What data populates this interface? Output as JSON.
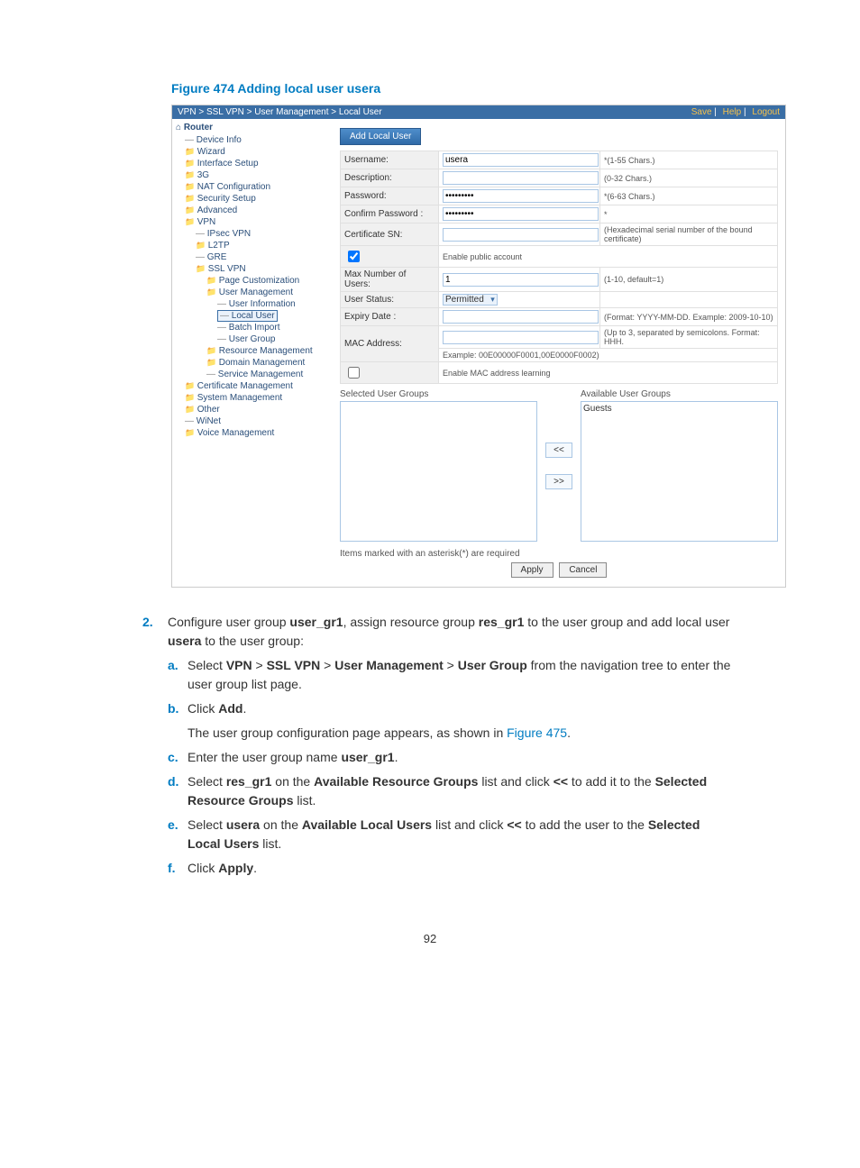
{
  "figure": {
    "caption": "Figure 474 Adding local user usera"
  },
  "crumb": {
    "path": "VPN > SSL VPN > User Management > Local User",
    "save": "Save",
    "help": "Help",
    "logout": "Logout"
  },
  "nav": {
    "root": "Router",
    "device_info": "Device Info",
    "wizard": "Wizard",
    "iface": "Interface Setup",
    "g3": "3G",
    "nat": "NAT Configuration",
    "sec": "Security Setup",
    "adv": "Advanced",
    "vpn": "VPN",
    "ipsec": "IPsec VPN",
    "l2tp": "L2TP",
    "gre": "GRE",
    "sslvpn": "SSL VPN",
    "pagec": "Page Customization",
    "usermgmt": "User Management",
    "userinfo": "User Information",
    "localuser": "Local User",
    "batch": "Batch Import",
    "usergroup": "User Group",
    "resmgmt": "Resource Management",
    "dommgmt": "Domain Management",
    "svcmgmt": "Service Management",
    "certmgmt": "Certificate Management",
    "sysmgmt": "System Management",
    "other": "Other",
    "winet": "WiNet",
    "voice": "Voice Management"
  },
  "form": {
    "button": "Add Local User",
    "username_l": "Username:",
    "username_v": "usera",
    "username_h": "*(1-55 Chars.)",
    "desc_l": "Description:",
    "desc_h": "(0-32 Chars.)",
    "pwd_l": "Password:",
    "pwd_v": "•••••••••",
    "pwd_h": "*(6-63 Chars.)",
    "cpwd_l": "Confirm Password :",
    "cpwd_v": "•••••••••",
    "cpwd_h": "*",
    "cert_l": "Certificate SN:",
    "cert_h": "(Hexadecimal serial number of the bound certificate)",
    "enable_pub": "Enable public account",
    "max_l": "Max Number of Users:",
    "max_v": "1",
    "max_h": "(1-10, default=1)",
    "status_l": "User Status:",
    "status_v": "Permitted",
    "expiry_l": "Expiry Date :",
    "expiry_h": "(Format: YYYY-MM-DD. Example: 2009-10-10)",
    "mac_l": "MAC Address:",
    "mac_h": "(Up to 3, separated by semicolons. Format: HHH.",
    "mac_ex": "Example: 00E00000F0001,00E0000F0002)",
    "enable_mac": "Enable MAC address learning",
    "sel_groups": "Selected User Groups",
    "avail_groups": "Available User Groups",
    "guests": "Guests",
    "move_l": "<<",
    "move_r": ">>",
    "note": "Items marked with an asterisk(*) are required",
    "apply": "Apply",
    "cancel": "Cancel"
  },
  "instr": {
    "num": "2.",
    "intro1": "Configure user group ",
    "b1": "user_gr1",
    "intro2": ", assign resource group ",
    "b2": "res_gr1",
    "intro3": " to the user group and add local user ",
    "b3": "usera",
    "intro4": " to the user group:",
    "a_m": "a.",
    "a_t1": "Select ",
    "a_b1": "VPN",
    "a_gt": " > ",
    "a_b2": "SSL VPN",
    "a_b3": "User Management",
    "a_b4": "User Group",
    "a_t2": " from the navigation tree to enter the user group list page.",
    "b_m": "b.",
    "b_t1": "Click ",
    "b_b1": "Add",
    "b_t2": ".",
    "b_after": "The user group configuration page appears, as shown in ",
    "b_link": "Figure 475",
    "b_dot": ".",
    "c_m": "c.",
    "c_t1": "Enter the user group name ",
    "c_b1": "user_gr1",
    "c_t2": ".",
    "d_m": "d.",
    "d_t1": "Select ",
    "d_b1": "res_gr1",
    "d_t2": " on the ",
    "d_b2": "Available Resource Groups",
    "d_t3": " list and click ",
    "d_b3": "<<",
    "d_t4": " to add it to the ",
    "d_b4": "Selected Resource Groups",
    "d_t5": " list.",
    "e_m": "e.",
    "e_t1": "Select ",
    "e_b1": "usera",
    "e_t2": " on the ",
    "e_b2": "Available Local Users",
    "e_t3": " list and click ",
    "e_b3": "<<",
    "e_t4": " to add the user to the ",
    "e_b4": "Selected Local Users",
    "e_t5": " list.",
    "f_m": "f.",
    "f_t1": "Click ",
    "f_b1": "Apply",
    "f_t2": "."
  },
  "page": {
    "num": "92"
  }
}
